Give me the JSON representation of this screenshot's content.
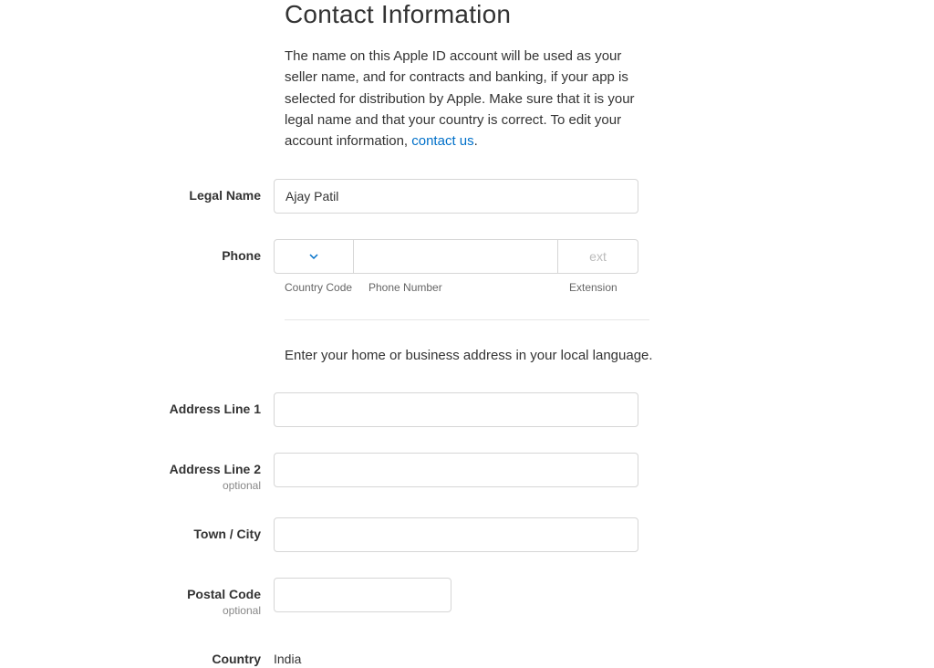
{
  "page": {
    "title": "Contact Information",
    "description_text": "The name on this Apple ID account will be used as your seller name, and for contracts and banking, if your app is selected for distribution by Apple. Make sure that it is your legal name and that your country is correct. To edit your account information, ",
    "contact_link": "contact us",
    "period": "."
  },
  "fields": {
    "legal_name": {
      "label": "Legal Name",
      "value": "Ajay Patil"
    },
    "phone": {
      "label": "Phone",
      "country_code_sublabel": "Country Code",
      "phone_number_sublabel": "Phone Number",
      "extension_sublabel": "Extension",
      "ext_placeholder": "ext"
    },
    "address_instruction": "Enter your home or business address in your local language.",
    "address_line_1": {
      "label": "Address Line 1",
      "value": ""
    },
    "address_line_2": {
      "label": "Address Line 2",
      "optional": "optional",
      "value": ""
    },
    "town_city": {
      "label": "Town / City",
      "value": ""
    },
    "postal_code": {
      "label": "Postal Code",
      "optional": "optional",
      "value": ""
    },
    "country": {
      "label": "Country",
      "value": "India"
    }
  }
}
